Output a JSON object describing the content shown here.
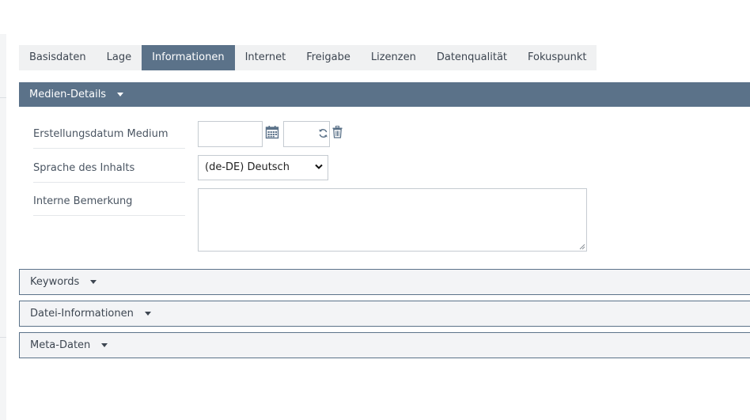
{
  "tabs": [
    {
      "label": "Basisdaten",
      "active": false
    },
    {
      "label": "Lage",
      "active": false
    },
    {
      "label": "Informationen",
      "active": true
    },
    {
      "label": "Internet",
      "active": false
    },
    {
      "label": "Freigabe",
      "active": false
    },
    {
      "label": "Lizenzen",
      "active": false
    },
    {
      "label": "Datenqualität",
      "active": false
    },
    {
      "label": "Fokuspunkt",
      "active": false
    }
  ],
  "media_details": {
    "title": "Medien-Details",
    "fields": {
      "creation_date": {
        "label": "Erstellungsdatum Medium",
        "date_value": "",
        "time_value": ""
      },
      "content_language": {
        "label": "Sprache des Inhalts",
        "selected": "(de-DE) Deutsch"
      },
      "internal_note": {
        "label": "Interne Bemerkung",
        "value": ""
      }
    }
  },
  "panels": {
    "keywords": {
      "title": "Keywords"
    },
    "file_info": {
      "title": "Datei-Informationen"
    },
    "meta_data": {
      "title": "Meta-Daten"
    }
  },
  "icons": {
    "calendar": "calendar-icon",
    "refresh": "refresh-icon",
    "delete": "trash-icon",
    "caret": "caret-down-icon"
  },
  "colors": {
    "accent": "#5b7289",
    "tab_bar": "#f0f1f2",
    "panel_bg": "#f3f4f6",
    "text": "#3d4651",
    "icon": "#5b7289"
  }
}
